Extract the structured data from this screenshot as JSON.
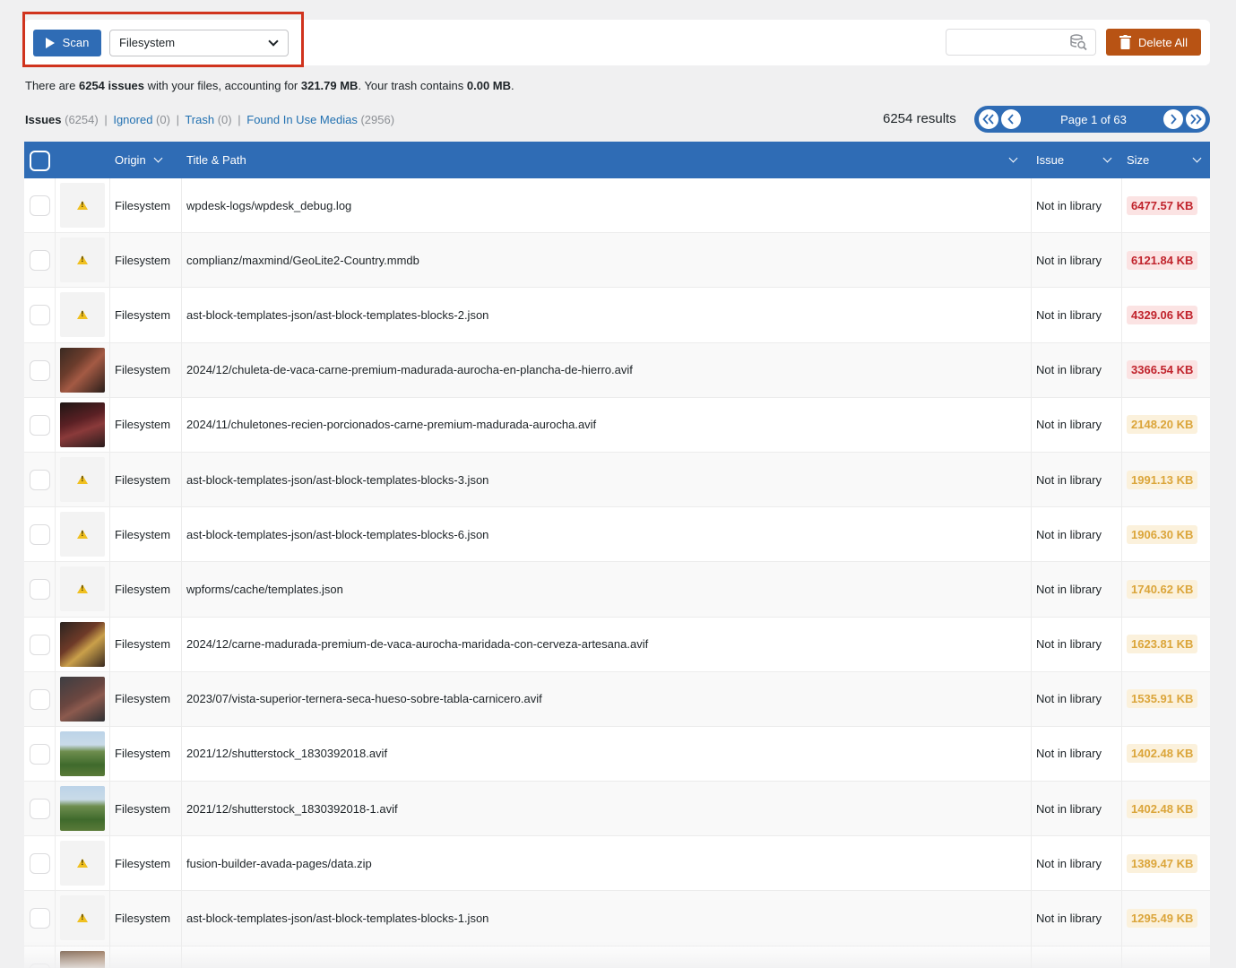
{
  "toolbar": {
    "scan_label": "Scan",
    "origin_value": "Filesystem",
    "search_placeholder": "",
    "delete_label": "Delete All"
  },
  "summary": {
    "pre": "There are ",
    "issues_count": "6254 issues",
    "mid1": " with your files, accounting for ",
    "size": "321.79 MB",
    "mid2": ". Your trash contains ",
    "trash": "0.00 MB",
    "post": "."
  },
  "filters": {
    "issues_label": "Issues",
    "issues_count": "(6254)",
    "ignored_label": "Ignored",
    "ignored_count": "(0)",
    "trash_label": "Trash",
    "trash_count": "(0)",
    "found_label": "Found In Use Medias",
    "found_count": "(2956)",
    "sep": "|"
  },
  "results_label": "6254 results",
  "pager": {
    "label": "Page 1 of 63"
  },
  "columns": {
    "origin": "Origin",
    "title": "Title & Path",
    "issue": "Issue",
    "size": "Size"
  },
  "colors": {
    "primary": "#2f6cb5",
    "delete": "#b85314",
    "highlight_box": "#d0331d",
    "size_red": "#c0232c",
    "size_orange": "#dba53a"
  },
  "rows": [
    {
      "thumb": "warning-icon",
      "origin": "Filesystem",
      "path": "wpdesk-logs/wpdesk_debug.log",
      "issue": "Not in library",
      "size": "6477.57 KB",
      "level": "red"
    },
    {
      "thumb": "warning-icon",
      "origin": "Filesystem",
      "path": "complianz/maxmind/GeoLite2-Country.mmdb",
      "issue": "Not in library",
      "size": "6121.84 KB",
      "level": "red"
    },
    {
      "thumb": "warning-icon",
      "origin": "Filesystem",
      "path": "ast-block-templates-json/ast-block-templates-blocks-2.json",
      "issue": "Not in library",
      "size": "4329.06 KB",
      "level": "red"
    },
    {
      "thumb": "image-meat-pan",
      "origin": "Filesystem",
      "path": "2024/12/chuleta-de-vaca-carne-premium-madurada-aurocha-en-plancha-de-hierro.avif",
      "issue": "Not in library",
      "size": "3366.54 KB",
      "level": "red"
    },
    {
      "thumb": "image-meat-cuts",
      "origin": "Filesystem",
      "path": "2024/11/chuletones-recien-porcionados-carne-premium-madurada-aurocha.avif",
      "issue": "Not in library",
      "size": "2148.20 KB",
      "level": "orange"
    },
    {
      "thumb": "warning-icon",
      "origin": "Filesystem",
      "path": "ast-block-templates-json/ast-block-templates-blocks-3.json",
      "issue": "Not in library",
      "size": "1991.13 KB",
      "level": "orange"
    },
    {
      "thumb": "warning-icon",
      "origin": "Filesystem",
      "path": "ast-block-templates-json/ast-block-templates-blocks-6.json",
      "issue": "Not in library",
      "size": "1906.30 KB",
      "level": "orange"
    },
    {
      "thumb": "warning-icon",
      "origin": "Filesystem",
      "path": "wpforms/cache/templates.json",
      "issue": "Not in library",
      "size": "1740.62 KB",
      "level": "orange"
    },
    {
      "thumb": "image-meat-beer",
      "origin": "Filesystem",
      "path": "2024/12/carne-madurada-premium-de-vaca-aurocha-maridada-con-cerveza-artesana.avif",
      "issue": "Not in library",
      "size": "1623.81 KB",
      "level": "orange"
    },
    {
      "thumb": "image-meat-board",
      "origin": "Filesystem",
      "path": "2023/07/vista-superior-ternera-seca-hueso-sobre-tabla-carnicero.avif",
      "issue": "Not in library",
      "size": "1535.91 KB",
      "level": "orange"
    },
    {
      "thumb": "image-landscape",
      "origin": "Filesystem",
      "path": "2021/12/shutterstock_1830392018.avif",
      "issue": "Not in library",
      "size": "1402.48 KB",
      "level": "orange"
    },
    {
      "thumb": "image-landscape",
      "origin": "Filesystem",
      "path": "2021/12/shutterstock_1830392018-1.avif",
      "issue": "Not in library",
      "size": "1402.48 KB",
      "level": "orange"
    },
    {
      "thumb": "warning-icon",
      "origin": "Filesystem",
      "path": "fusion-builder-avada-pages/data.zip",
      "issue": "Not in library",
      "size": "1389.47 KB",
      "level": "orange"
    },
    {
      "thumb": "warning-icon",
      "origin": "Filesystem",
      "path": "ast-block-templates-json/ast-block-templates-blocks-1.json",
      "issue": "Not in library",
      "size": "1295.49 KB",
      "level": "orange"
    },
    {
      "thumb": "image-meat-cut-partial",
      "origin": "",
      "path": "",
      "issue": "",
      "size": "",
      "level": "orange"
    }
  ]
}
